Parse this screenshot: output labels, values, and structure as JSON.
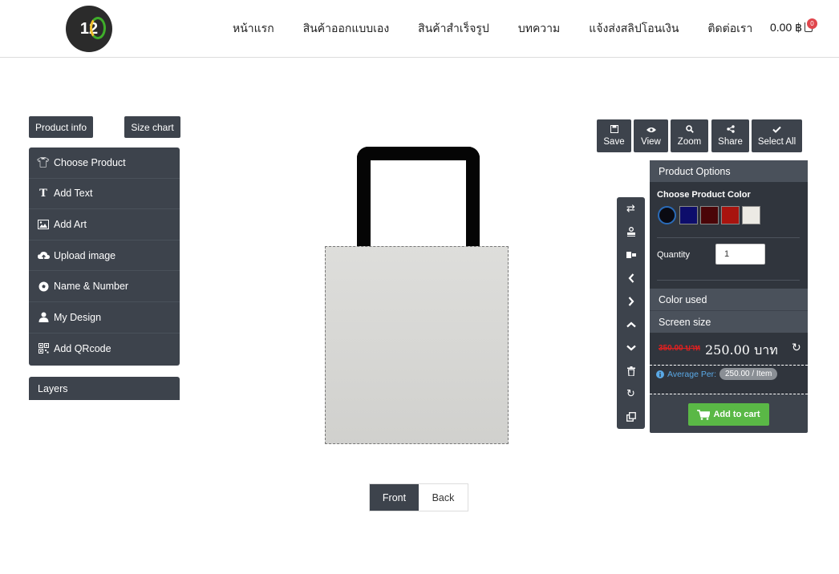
{
  "header": {
    "logo_text": "12",
    "nav": [
      "หน้าแรก",
      "สินค้าออกแบบเอง",
      "สินค้าสำเร็จรูป",
      "บทความ",
      "แจ้งส่งสลิปโอนเงิน",
      "ติดต่อเรา"
    ],
    "cart_total": "0.00 ฿",
    "cart_count": "0"
  },
  "left": {
    "product_info": "Product info",
    "size_chart": "Size chart",
    "menu": [
      {
        "label": "Choose Product",
        "icon": "shirt-icon"
      },
      {
        "label": "Add Text",
        "icon": "text-icon"
      },
      {
        "label": "Add Art",
        "icon": "image-icon"
      },
      {
        "label": "Upload image",
        "icon": "cloud-upload-icon"
      },
      {
        "label": "Name & Number",
        "icon": "soccer-ball-icon"
      },
      {
        "label": "My Design",
        "icon": "user-icon"
      },
      {
        "label": "Add QRcode",
        "icon": "qrcode-icon"
      }
    ],
    "layers": "Layers"
  },
  "canvas": {
    "tabs": [
      "Front",
      "Back"
    ],
    "active_tab": "Front"
  },
  "toolbar": [
    "Save",
    "View",
    "Zoom",
    "Share",
    "Select All"
  ],
  "options": {
    "title": "Product Options",
    "color_label": "Choose Product Color",
    "colors": [
      "#0a0a12",
      "#0d0d6b",
      "#4a0508",
      "#a8140f",
      "#eceae4"
    ],
    "selected_color": "#0a0a12",
    "quantity_label": "Quantity",
    "quantity": "1",
    "color_used": "Color used",
    "screen_size": "Screen size",
    "old_price": "350.00 บาท",
    "price": "250.00 บาท",
    "average_label": "Average Per:",
    "average_value": "250.00 / Item",
    "add_to_cart": "Add to cart"
  },
  "accent_colors": {
    "dark": "#3d434c",
    "green": "#5ab846",
    "red": "#e0464d"
  }
}
